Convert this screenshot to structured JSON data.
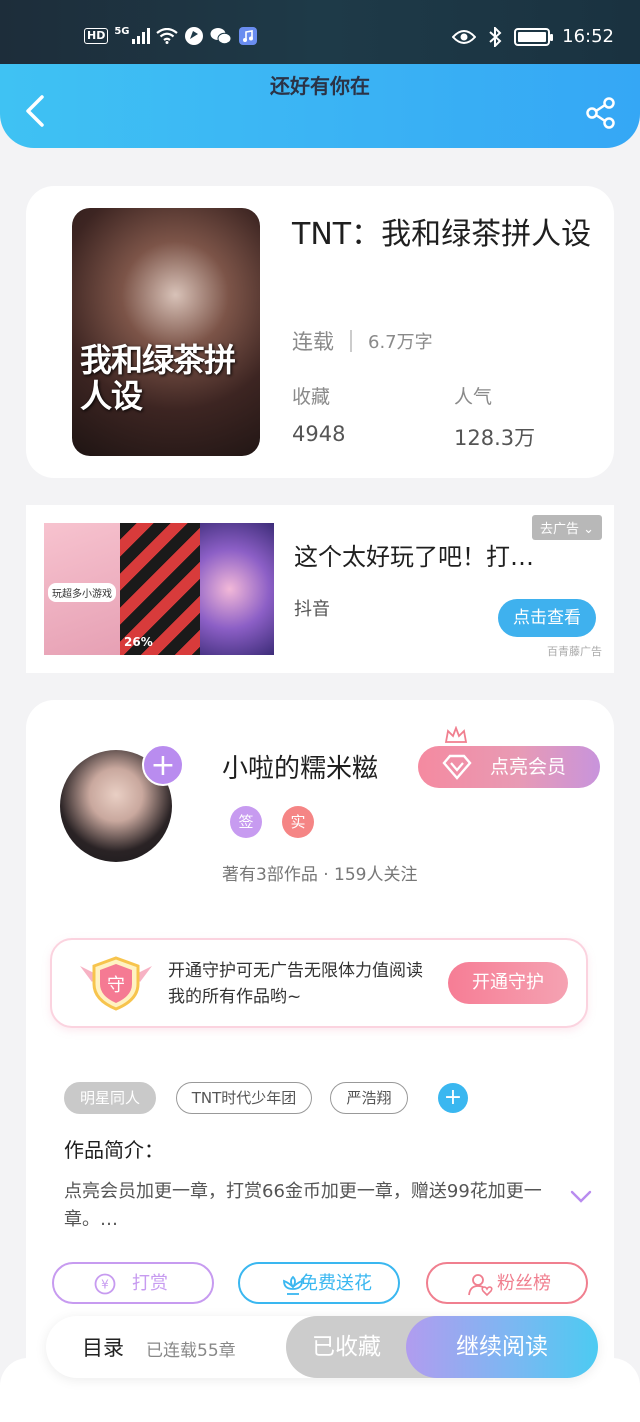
{
  "status_bar": {
    "hd": "HD",
    "network": "5G",
    "time": "16:52"
  },
  "header": {
    "title": "还好有你在"
  },
  "book": {
    "cover_title": "我和绿茶拼人设",
    "title": "TNT：我和绿茶拼人设",
    "status": "连载",
    "word_count": "6.7万字",
    "stats": [
      {
        "label": "收藏",
        "value": "4948"
      },
      {
        "label": "人气",
        "value": "128.3万"
      }
    ]
  },
  "ad": {
    "badge": "去广告",
    "title": "这个太好玩了吧！打…",
    "source_app": "抖音",
    "cta": "点击查看",
    "provider": "百青藤广告",
    "img_tag": "玩超多小游戏",
    "img_pct": "26%"
  },
  "author": {
    "name": "小啦的糯米糍",
    "vip_label": "点亮会员",
    "badges": [
      {
        "label": "签",
        "color": "#c79bf0"
      },
      {
        "label": "实",
        "color": "#f58585"
      }
    ],
    "works_info": "著有3部作品 · 159人关注"
  },
  "guard": {
    "icon_text": "守",
    "text": "开通守护可无广告无限体力值阅读我的所有作品哟~",
    "button": "开通守护"
  },
  "tags": [
    "明星同人",
    "TNT时代少年团",
    "严浩翔"
  ],
  "intro": {
    "title": "作品简介：",
    "text": "点亮会员加更一章，打赏66金币加更一章，赠送99花加更一章。…"
  },
  "actions": [
    {
      "label": "打赏",
      "color": "#c79bf0"
    },
    {
      "label": "免费送花",
      "color": "#3ab7f0"
    },
    {
      "label": "粉丝榜",
      "color": "#f07f8f"
    }
  ],
  "bottom": {
    "toc": "目录",
    "chapters": "已连载55章",
    "collected": "已收藏",
    "continue": "继续阅读"
  }
}
